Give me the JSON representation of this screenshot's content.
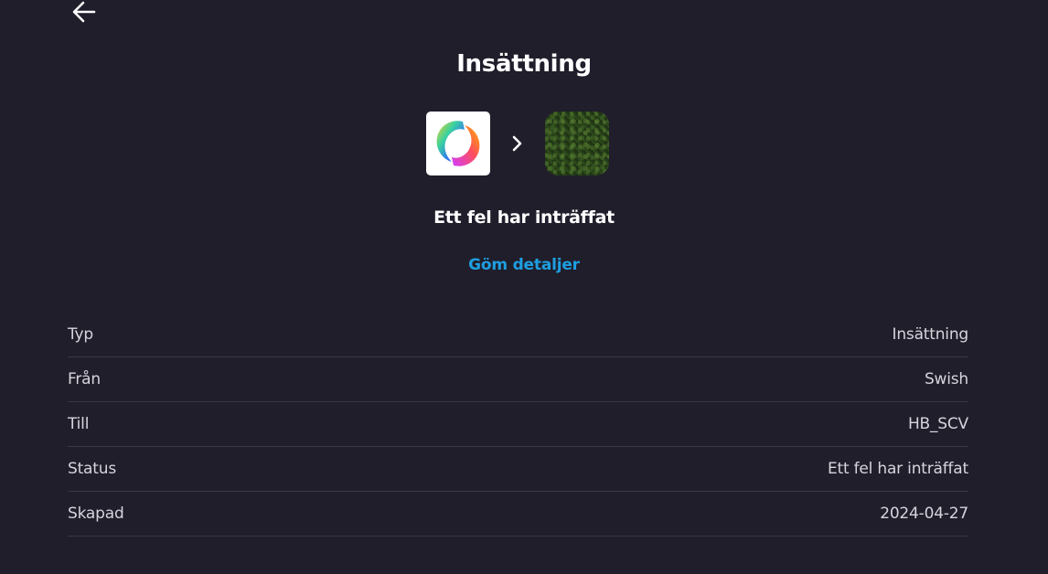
{
  "header": {
    "back_icon": "arrow-left-icon",
    "title": "Insättning"
  },
  "flow": {
    "source_icon": "swish-logo",
    "arrow_icon": "chevron-right-icon",
    "destination_icon": "grass-avatar"
  },
  "status": {
    "heading": "Ett fel har inträffat"
  },
  "toggle_details_label": "Göm detaljer",
  "details": [
    {
      "label": "Typ",
      "value": "Insättning"
    },
    {
      "label": "Från",
      "value": "Swish"
    },
    {
      "label": "Till",
      "value": "HB_SCV"
    },
    {
      "label": "Status",
      "value": "Ett fel har inträffat"
    },
    {
      "label": "Skapad",
      "value": "2024-04-27"
    }
  ],
  "colors": {
    "background": "#201e2b",
    "accent": "#1e9ee0",
    "text": "#ffffff",
    "muted_text": "#d6d5dc",
    "divider": "#3a3847"
  }
}
